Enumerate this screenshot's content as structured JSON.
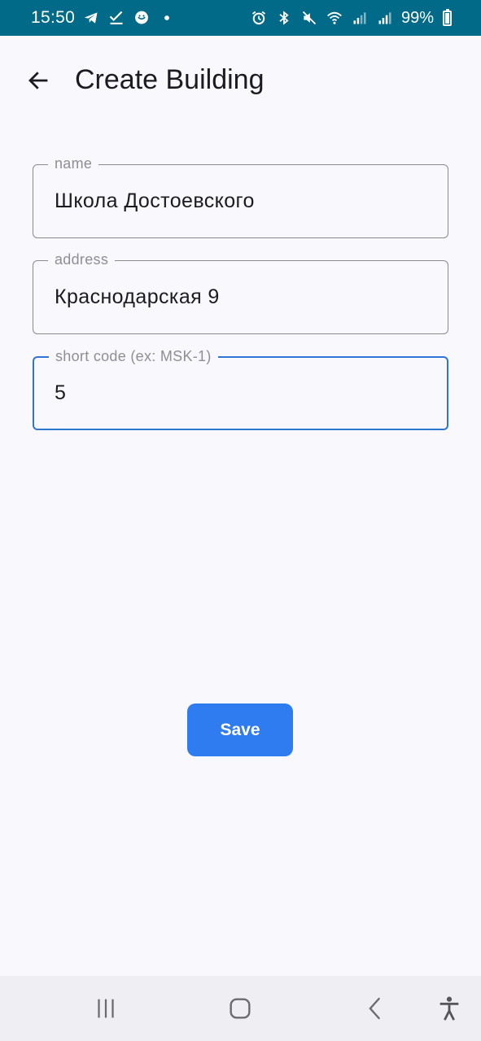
{
  "status_bar": {
    "time": "15:50",
    "battery": "99%",
    "left_icons": [
      "telegram-icon",
      "check-icon",
      "chat-bubble-icon",
      "dot-icon"
    ],
    "right_icons": [
      "alarm-icon",
      "bluetooth-icon",
      "mute-icon",
      "wifi-icon",
      "signal-icon",
      "signal-icon-2",
      "battery-icon"
    ]
  },
  "app_bar": {
    "title": "Create Building",
    "back_icon": "arrow-left-icon"
  },
  "form": {
    "name": {
      "label": "name",
      "value": "Школа Достоевского"
    },
    "address": {
      "label": "address",
      "value": "Краснодарская 9"
    },
    "short_code": {
      "label": "short code (ex: MSK-1)",
      "value": "5"
    }
  },
  "actions": {
    "save_label": "Save"
  },
  "nav_bar": {
    "icons": [
      "recent-apps-icon",
      "home-icon",
      "back-nav-icon",
      "accessibility-icon"
    ]
  },
  "colors": {
    "status_bar_bg": "#006a88",
    "accent": "#2f7cf1",
    "focus_border": "#2e75d4",
    "background": "#f9f9fd"
  }
}
